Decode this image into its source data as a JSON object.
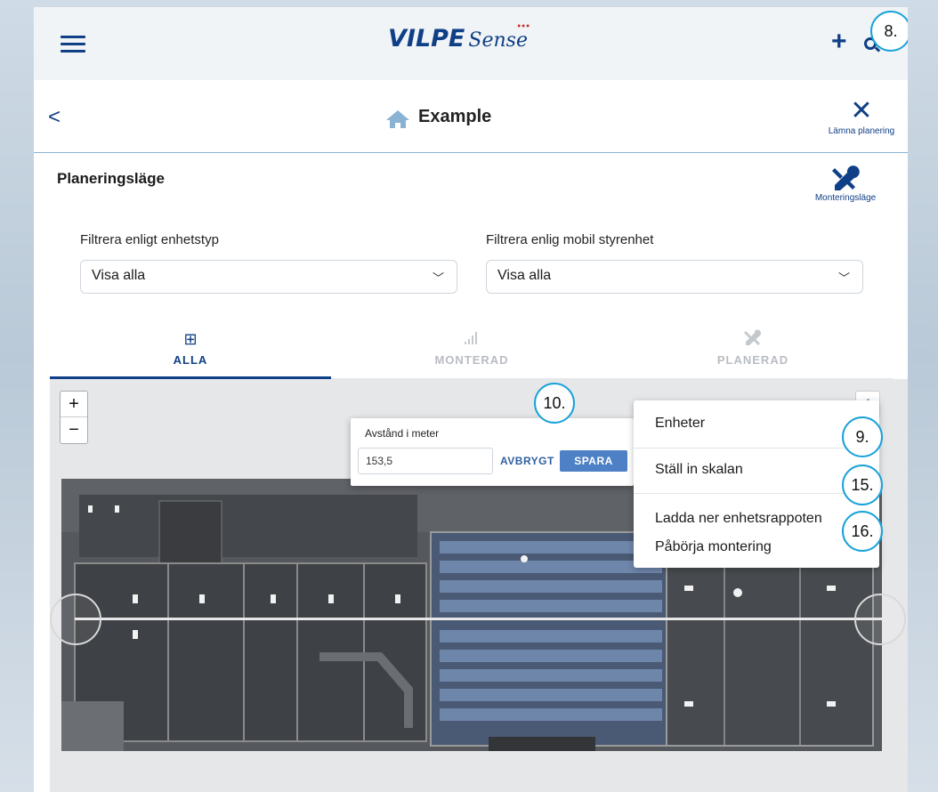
{
  "header": {
    "logo_brand": "VILPE",
    "logo_product": "Sense",
    "add_label": "+"
  },
  "titlebar": {
    "back_label": "<",
    "title": "Example",
    "exit_label": "Lämna planering"
  },
  "planning": {
    "title": "Planeringsläge",
    "mount_label": "Monteringsläge"
  },
  "filters": [
    {
      "label": "Filtrera enligt enhetstyp",
      "value": "Visa alla"
    },
    {
      "label": "Filtrera enlig mobil styrenhet",
      "value": "Visa alla"
    }
  ],
  "tabs": [
    {
      "label": "ALLA",
      "icon": "grid-icon",
      "active": true
    },
    {
      "label": "MONTERAD",
      "icon": "signal-bars-icon",
      "active": false
    },
    {
      "label": "PLANERAD",
      "icon": "tools-icon",
      "active": false
    }
  ],
  "map": {
    "zoom_in": "+",
    "zoom_out": "−"
  },
  "distance_dialog": {
    "label": "Avstånd i meter",
    "value": "153,5",
    "cancel_label": "AVBRYGT",
    "save_label": "SPARA"
  },
  "menu": {
    "items": [
      "Enheter",
      "Ställ in skalan",
      "Ladda ner enhetsrappoten",
      "Påbörja montering"
    ]
  },
  "callouts": [
    "8.",
    "10.",
    "9.",
    "15.",
    "16."
  ],
  "colors": {
    "accent": "#0f3f86",
    "callout": "#19a2d8",
    "save_button": "#4d80c4"
  }
}
